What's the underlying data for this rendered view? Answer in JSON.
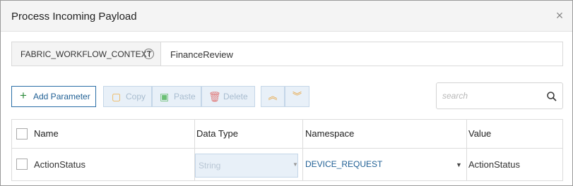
{
  "dialog": {
    "title": "Process Incoming Payload",
    "close_glyph": "×"
  },
  "context": {
    "label": "FABRIC_WORKFLOW_CONTEXT",
    "help_glyph": "?",
    "value": "FinanceReview"
  },
  "toolbar": {
    "add_label": "Add Parameter",
    "copy_label": "Copy",
    "paste_label": "Paste",
    "delete_label": "Delete",
    "icons": {
      "add": "plus-icon",
      "copy": "copy-icon",
      "paste": "paste-icon",
      "delete": "trash-icon",
      "up": "double-chevron-up-icon",
      "down": "double-chevron-down-icon"
    }
  },
  "search": {
    "placeholder": "search",
    "value": ""
  },
  "grid": {
    "columns": [
      "Name",
      "Data Type",
      "Namespace",
      "Value"
    ],
    "rows": [
      {
        "name": "ActionStatus",
        "data_type": "String",
        "namespace": "DEVICE_REQUEST",
        "value": "ActionStatus",
        "checked": false
      }
    ]
  },
  "colors": {
    "accent": "#1f5f94",
    "add_icon": "#2c8a3a",
    "disabled_bg": "#e8f0f8",
    "disabled_text": "#a8bccf",
    "header_bg": "#f4f4f4"
  }
}
